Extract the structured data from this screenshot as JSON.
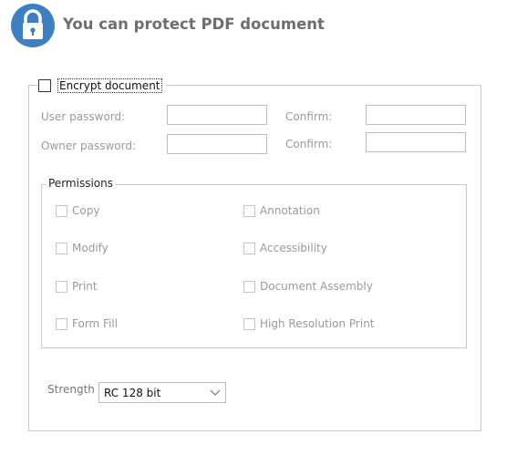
{
  "header": {
    "title": "You can protect PDF document",
    "icon": "lock-icon",
    "accent_color": "#3d7fc1"
  },
  "encrypt": {
    "label": "Encrypt document",
    "checked": false
  },
  "passwords": {
    "user_label": "User password:",
    "owner_label": "Owner password:",
    "confirm_label": "Confirm:",
    "user_value": "",
    "user_confirm_value": "",
    "owner_value": "",
    "owner_confirm_value": ""
  },
  "permissions": {
    "title": "Permissions",
    "items": [
      {
        "label": "Copy",
        "checked": false
      },
      {
        "label": "Annotation",
        "checked": false
      },
      {
        "label": "Modify",
        "checked": false
      },
      {
        "label": "Accessibility",
        "checked": false
      },
      {
        "label": "Print",
        "checked": false
      },
      {
        "label": "Document Assembly",
        "checked": false
      },
      {
        "label": "Form Fill",
        "checked": false
      },
      {
        "label": "High Resolution Print",
        "checked": false
      }
    ]
  },
  "strength": {
    "label": "Strength",
    "selected": "RC 128 bit"
  }
}
